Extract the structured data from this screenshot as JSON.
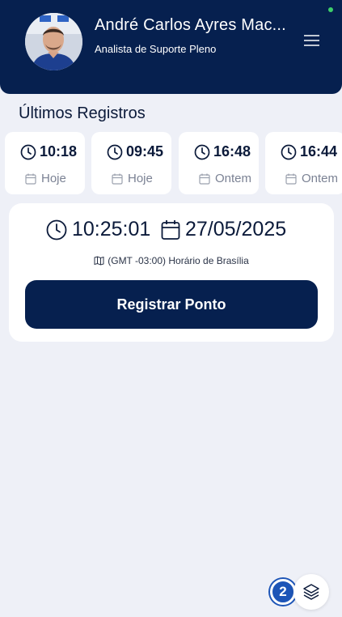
{
  "user": {
    "name": "André Carlos Ayres Mac...",
    "role": "Analista de Suporte Pleno"
  },
  "records_title": "Últimos Registros",
  "records": [
    {
      "time": "10:18",
      "day": "Hoje"
    },
    {
      "time": "09:45",
      "day": "Hoje"
    },
    {
      "time": "16:48",
      "day": "Ontem"
    },
    {
      "time": "16:44",
      "day": "Ontem"
    }
  ],
  "clock": {
    "time": "10:25:01",
    "date": "27/05/2025",
    "timezone": "(GMT -03:00) Horário de Brasília"
  },
  "register_button": "Registrar Ponto",
  "badge_count": "2",
  "colors": {
    "primary": "#06204f",
    "background": "#eef0f7",
    "status": "#3ecf6a",
    "badge": "#1d55b7"
  },
  "icons": [
    "menu-icon",
    "clock-icon",
    "calendar-icon",
    "map-icon",
    "layers-icon"
  ]
}
